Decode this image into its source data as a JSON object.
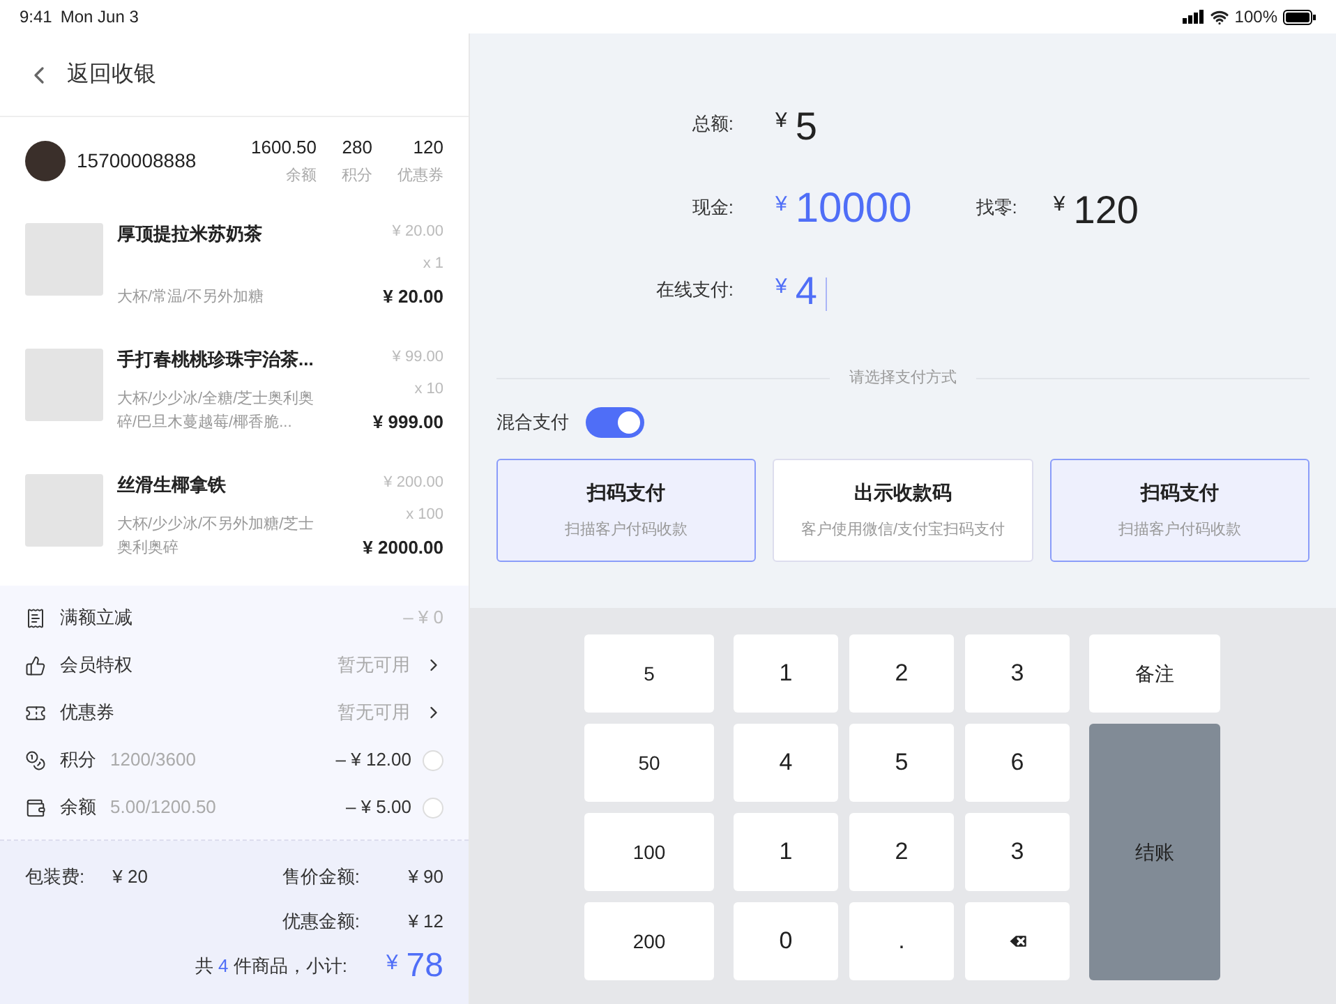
{
  "status_bar": {
    "time": "9:41",
    "date": "Mon Jun 3",
    "battery": "100%"
  },
  "header": {
    "back_label": "返回收银"
  },
  "member": {
    "phone": "15700008888",
    "stats": [
      {
        "value": "1600.50",
        "label": "余额"
      },
      {
        "value": "280",
        "label": "积分"
      },
      {
        "value": "120",
        "label": "优惠券"
      }
    ]
  },
  "items": [
    {
      "name": "厚顶提拉米苏奶茶",
      "options": "大杯/常温/不另外加糖",
      "unit_price": "¥ 20.00",
      "quantity": "x 1",
      "total": "¥ 20.00"
    },
    {
      "name": "手打春桃桃珍珠宇治茶...",
      "options": "大杯/少少冰/全糖/芝士奥利奥碎/巴旦木蔓越莓/椰香脆...",
      "unit_price": "¥ 99.00",
      "quantity": "x 10",
      "total": "¥ 999.00"
    },
    {
      "name": "丝滑生椰拿铁",
      "options": "大杯/少少冰/不另外加糖/芝士奥利奥碎",
      "unit_price": "¥ 200.00",
      "quantity": "x 100",
      "total": "¥ 2000.00"
    }
  ],
  "discounts": [
    {
      "kind": "amount",
      "label": "满额立减",
      "value": "–  ¥ 0"
    },
    {
      "kind": "link",
      "label": "会员特权",
      "value": "暂无可用"
    },
    {
      "kind": "link",
      "label": "优惠券",
      "value": "暂无可用"
    },
    {
      "kind": "radio",
      "label": "积分",
      "detail": "1200/3600",
      "value": "–  ¥ 12.00",
      "checked": false
    },
    {
      "kind": "radio",
      "label": "余额",
      "detail": "5.00/1200.50",
      "value": "–  ¥ 5.00",
      "checked": false
    }
  ],
  "summary": {
    "packaging_label": "包装费:",
    "packaging_value": "¥ 20",
    "sale_label": "售价金额:",
    "sale_value": "¥ 90",
    "discount_label": "优惠金额:",
    "discount_value": "¥ 12",
    "count_prefix": "共",
    "count": "4",
    "count_suffix": "件商品，小计:",
    "subtotal_currency": "¥",
    "subtotal": "78"
  },
  "amounts": {
    "total": {
      "label": "总额:",
      "currency": "¥",
      "value": "5"
    },
    "cash": {
      "label": "现金:",
      "currency": "¥",
      "value": "10000"
    },
    "change": {
      "label": "找零:",
      "currency": "¥",
      "value": "120"
    },
    "online": {
      "label": "在线支付:",
      "currency": "¥",
      "value": "4"
    }
  },
  "payment": {
    "prompt": "请选择支付方式",
    "mixed_label": "混合支付",
    "mixed_on": true,
    "methods": [
      {
        "title": "扫码支付",
        "subtitle": "扫描客户付码收款",
        "selected": true
      },
      {
        "title": "出示收款码",
        "subtitle": "客户使用微信/支付宝扫码支付",
        "selected": false
      },
      {
        "title": "扫码支付",
        "subtitle": "扫描客户付码收款",
        "selected": true
      }
    ]
  },
  "keypad": {
    "quick": [
      "5",
      "50",
      "100",
      "200"
    ],
    "keys": [
      {
        "kind": "digit",
        "label": "1"
      },
      {
        "kind": "digit",
        "label": "2"
      },
      {
        "kind": "digit",
        "label": "3"
      },
      {
        "kind": "digit",
        "label": "4"
      },
      {
        "kind": "digit",
        "label": "5"
      },
      {
        "kind": "digit",
        "label": "6"
      },
      {
        "kind": "digit",
        "label": "1"
      },
      {
        "kind": "digit",
        "label": "2"
      },
      {
        "kind": "digit",
        "label": "3"
      },
      {
        "kind": "digit",
        "label": "0"
      },
      {
        "kind": "digit",
        "label": "."
      },
      {
        "kind": "backspace"
      }
    ],
    "note_label": "备注",
    "checkout_label": "结账"
  }
}
